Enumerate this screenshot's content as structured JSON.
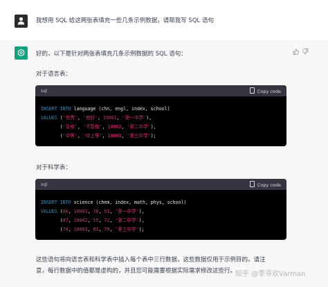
{
  "user": {
    "message": "我想用 SQL 给这两张表填充一些几条示例数据，请帮我写 SQL 语句"
  },
  "assistant": {
    "intro": "好的，以下是针对两张表填充几条示例数据的 SQL 语句：",
    "section1_label": "对于语言表：",
    "section2_label": "对于科学表：",
    "code_lang": "sql",
    "copy_label": "Copy code",
    "code1": {
      "line1_kw1": "INSERT INTO",
      "line1_rest": " language (chn, engl, index, school)",
      "line2_kw": "VALUES",
      "line2_rest": " (",
      "row1": [
        "'优秀'",
        "'良好'",
        "10001",
        "'第一中学'"
      ],
      "row2": [
        "'及格'",
        "'不及格'",
        "10002",
        "'第二中学'"
      ],
      "row3": [
        "'中等'",
        "'中上等'",
        "10003",
        "'第三中学'"
      ]
    },
    "code2": {
      "line1_kw1": "INSERT INTO",
      "line1_rest": " science (chem, index, math, phys, school)",
      "line2_kw": "VALUES",
      "row1": [
        "80",
        "10001",
        "78",
        "91",
        "'第一中学'"
      ],
      "row2": [
        "87",
        "10002",
        "55",
        "72",
        "'第二中学'"
      ],
      "row3": [
        "76",
        "10003",
        "81",
        "79",
        "'第三中学'"
      ]
    },
    "footer_line1": "这些语句将向语言表和科学表中插入每个表中三行数据，这些数据仅用于示例目的。请注",
    "footer_line2": "意，每行数据中的值都是虚构的，并且您可能需要根据实际需求修改这些行。"
  },
  "icons": {
    "thumb_up": "thumb-up-icon",
    "thumb_down": "thumb-down-icon",
    "copy": "clipboard-icon"
  },
  "watermark": "知乎 @李寻欢Varman"
}
